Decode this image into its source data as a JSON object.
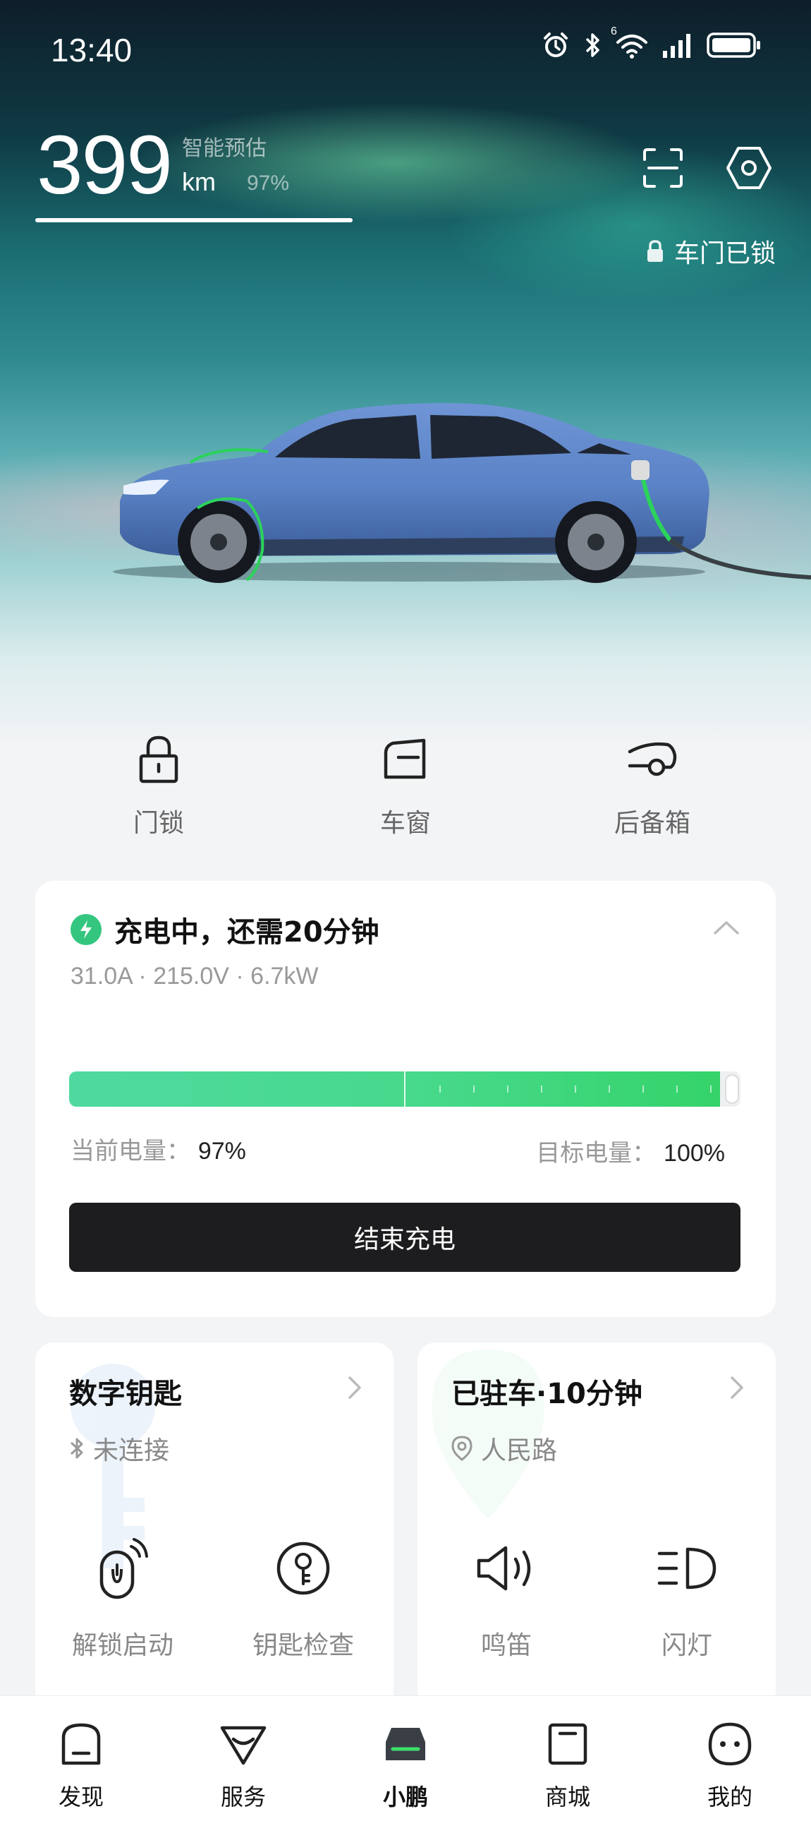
{
  "status_bar": {
    "time": "13:40",
    "network_label": "6"
  },
  "vehicle": {
    "range_value": "399",
    "range_unit": "km",
    "range_mode": "智能预估",
    "battery_percent": "97%",
    "lock_status": "车门已锁"
  },
  "quick_controls": [
    {
      "label": "门锁",
      "icon": "padlock-icon"
    },
    {
      "label": "车窗",
      "icon": "window-icon"
    },
    {
      "label": "后备箱",
      "icon": "trunk-icon"
    }
  ],
  "charging": {
    "title": "充电中，还需20分钟",
    "stats": "31.0A · 215.0V · 6.7kW",
    "current_label": "当前电量：",
    "current_value": "97%",
    "target_label": "目标电量：",
    "target_value": "100%",
    "progress": 0.97,
    "end_button": "结束充电",
    "accent": "#34c67f"
  },
  "digital_key": {
    "title": "数字钥匙",
    "status": "未连接",
    "actions": [
      {
        "label": "解锁启动",
        "icon": "remote-start-icon"
      },
      {
        "label": "钥匙检查",
        "icon": "key-check-icon"
      }
    ]
  },
  "parking": {
    "title": "已驻车·10分钟",
    "location": "人民路",
    "actions": [
      {
        "label": "鸣笛",
        "icon": "horn-icon"
      },
      {
        "label": "闪灯",
        "icon": "headlight-icon"
      }
    ]
  },
  "bottom_nav": [
    {
      "label": "发现",
      "icon": "discover-icon",
      "active": false
    },
    {
      "label": "服务",
      "icon": "service-icon",
      "active": false
    },
    {
      "label": "小鹏",
      "icon": "car-icon",
      "active": true
    },
    {
      "label": "商城",
      "icon": "shop-icon",
      "active": false
    },
    {
      "label": "我的",
      "icon": "profile-icon",
      "active": false
    }
  ]
}
